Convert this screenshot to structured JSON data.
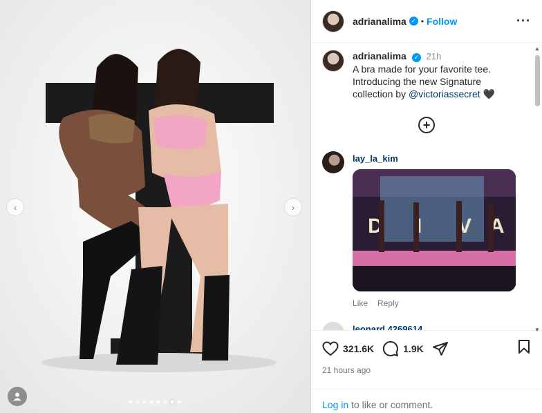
{
  "header": {
    "username": "adrianalima",
    "separator": "•",
    "follow_label": "Follow",
    "more_icon": "more-horizontal-icon"
  },
  "caption": {
    "username": "adrianalima",
    "time": "21h",
    "text_before_mention": "A bra made for your favorite tee. Introducing the new Signature collection by ",
    "mention": "@victoriassecret",
    "emoji": "🖤"
  },
  "load_more_icon": "plus-circle-icon",
  "comments": [
    {
      "username": "lay_la_kim",
      "gif_text": [
        "D",
        "I",
        "V",
        "A"
      ],
      "like_label": "Like",
      "reply_label": "Reply"
    },
    {
      "username": "leonard.4269614"
    }
  ],
  "stats": {
    "likes": "321.6K",
    "comments": "1.9K",
    "time_ago": "21 hours ago"
  },
  "login": {
    "link": "Log in",
    "text": " to like or comment."
  },
  "carousel": {
    "slide_count": 8,
    "active_index": 6
  },
  "colors": {
    "accent": "#0095f6",
    "mention": "#00376b",
    "secondary_text": "#737373"
  }
}
